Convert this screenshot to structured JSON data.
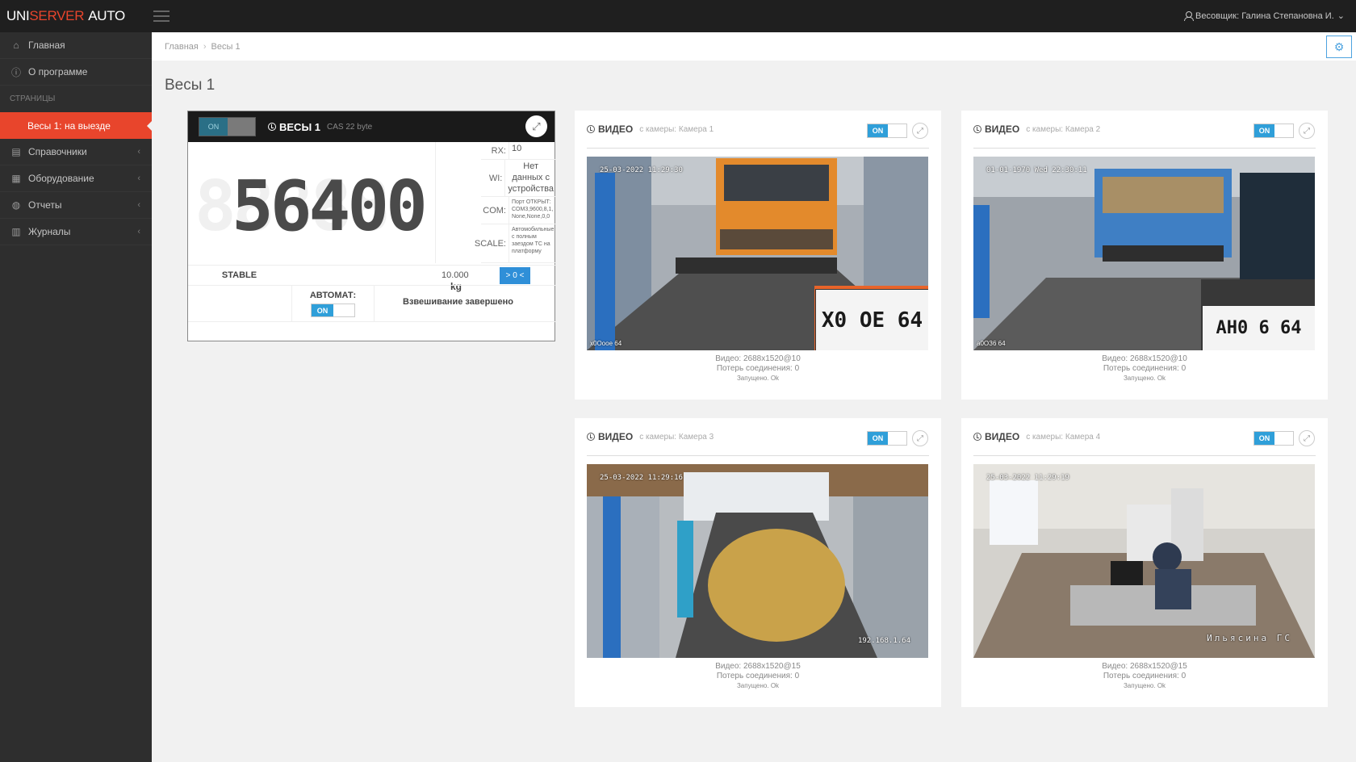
{
  "topbar": {
    "brand_uni": "UNI",
    "brand_server": "SERVER",
    "brand_auto": "AUTO",
    "user": "Весовщик: Галина Степановна И."
  },
  "sidebar": {
    "items_top": [
      {
        "label": "Главная",
        "icon": "home-icon"
      },
      {
        "label": "О программе",
        "icon": "info-icon"
      }
    ],
    "section": "СТРАНИЦЫ",
    "active": "Весы 1: на выезде",
    "items_bottom": [
      {
        "label": "Справочники",
        "icon": "book-icon"
      },
      {
        "label": "Оборудование",
        "icon": "list-icon"
      },
      {
        "label": "Отчеты",
        "icon": "report-icon"
      },
      {
        "label": "Журналы",
        "icon": "journal-icon"
      }
    ]
  },
  "breadcrumb": [
    "Главная",
    "Весы 1"
  ],
  "page_title": "Весы 1",
  "scale": {
    "toggle": "ON",
    "title": "ВЕСЫ 1",
    "subtitle": "CAS 22 byte",
    "weight": "56400",
    "weight_bg": "88888",
    "unit": "kg",
    "rx_label": "RX:",
    "rx_value": "10",
    "wi_label": "WI:",
    "wi_value": "Нет данных с устройства",
    "com_label": "COM:",
    "com_value": "Порт ОТКРЫТ: COM3,9600,8,1, None,None,0,0",
    "scale_label": "SCALE:",
    "scale_value": "Автомобильные с полным заездом ТС на платформу",
    "stable": "STABLE",
    "range": "10.000",
    "zero_btn": "> 0 <",
    "auto_label": "АВТОМАТ:",
    "auto_toggle": "ON",
    "status": "Взвешивание завершено"
  },
  "videos": [
    {
      "title": "ВИДЕО",
      "source": "с камеры: Камера 1",
      "toggle": "ON",
      "stamp": "25-03-2022 11:29:30",
      "plate_label": "х0Ооое 64",
      "plate": "Х0 ОЕ 64",
      "res": "Видео: 2688x1520@10",
      "loss": "Потерь соединения: 0",
      "started": "Запущено. Ok"
    },
    {
      "title": "ВИДЕО",
      "source": "с камеры: Камера 2",
      "toggle": "ON",
      "stamp": "01-01-1970 Wed 22:30:11",
      "plate_label": "а0ОЗ6 64",
      "plate": "АН0 6 64",
      "res": "Видео: 2688x1520@10",
      "loss": "Потерь соединения: 0",
      "started": "Запущено. Ok"
    },
    {
      "title": "ВИДЕО",
      "source": "с камеры: Камера 3",
      "toggle": "ON",
      "stamp": "25-03-2022 11:29:16",
      "ip": "192.168.1.64",
      "res": "Видео: 2688x1520@15",
      "loss": "Потерь соединения: 0",
      "started": "Запущено. Ok"
    },
    {
      "title": "ВИДЕО",
      "source": "с камеры: Камера 4",
      "toggle": "ON",
      "stamp": "25-03-2022 11:29:19",
      "cam_name": "Ильясина ГС",
      "res": "Видео: 2688x1520@15",
      "loss": "Потерь соединения: 0",
      "started": "Запущено. Ok"
    }
  ],
  "colors": {
    "accent": "#e8452c",
    "toggle_on": "#2f9fd9",
    "sidebar": "#2e2e2e",
    "topbar": "#1f1f1f"
  }
}
